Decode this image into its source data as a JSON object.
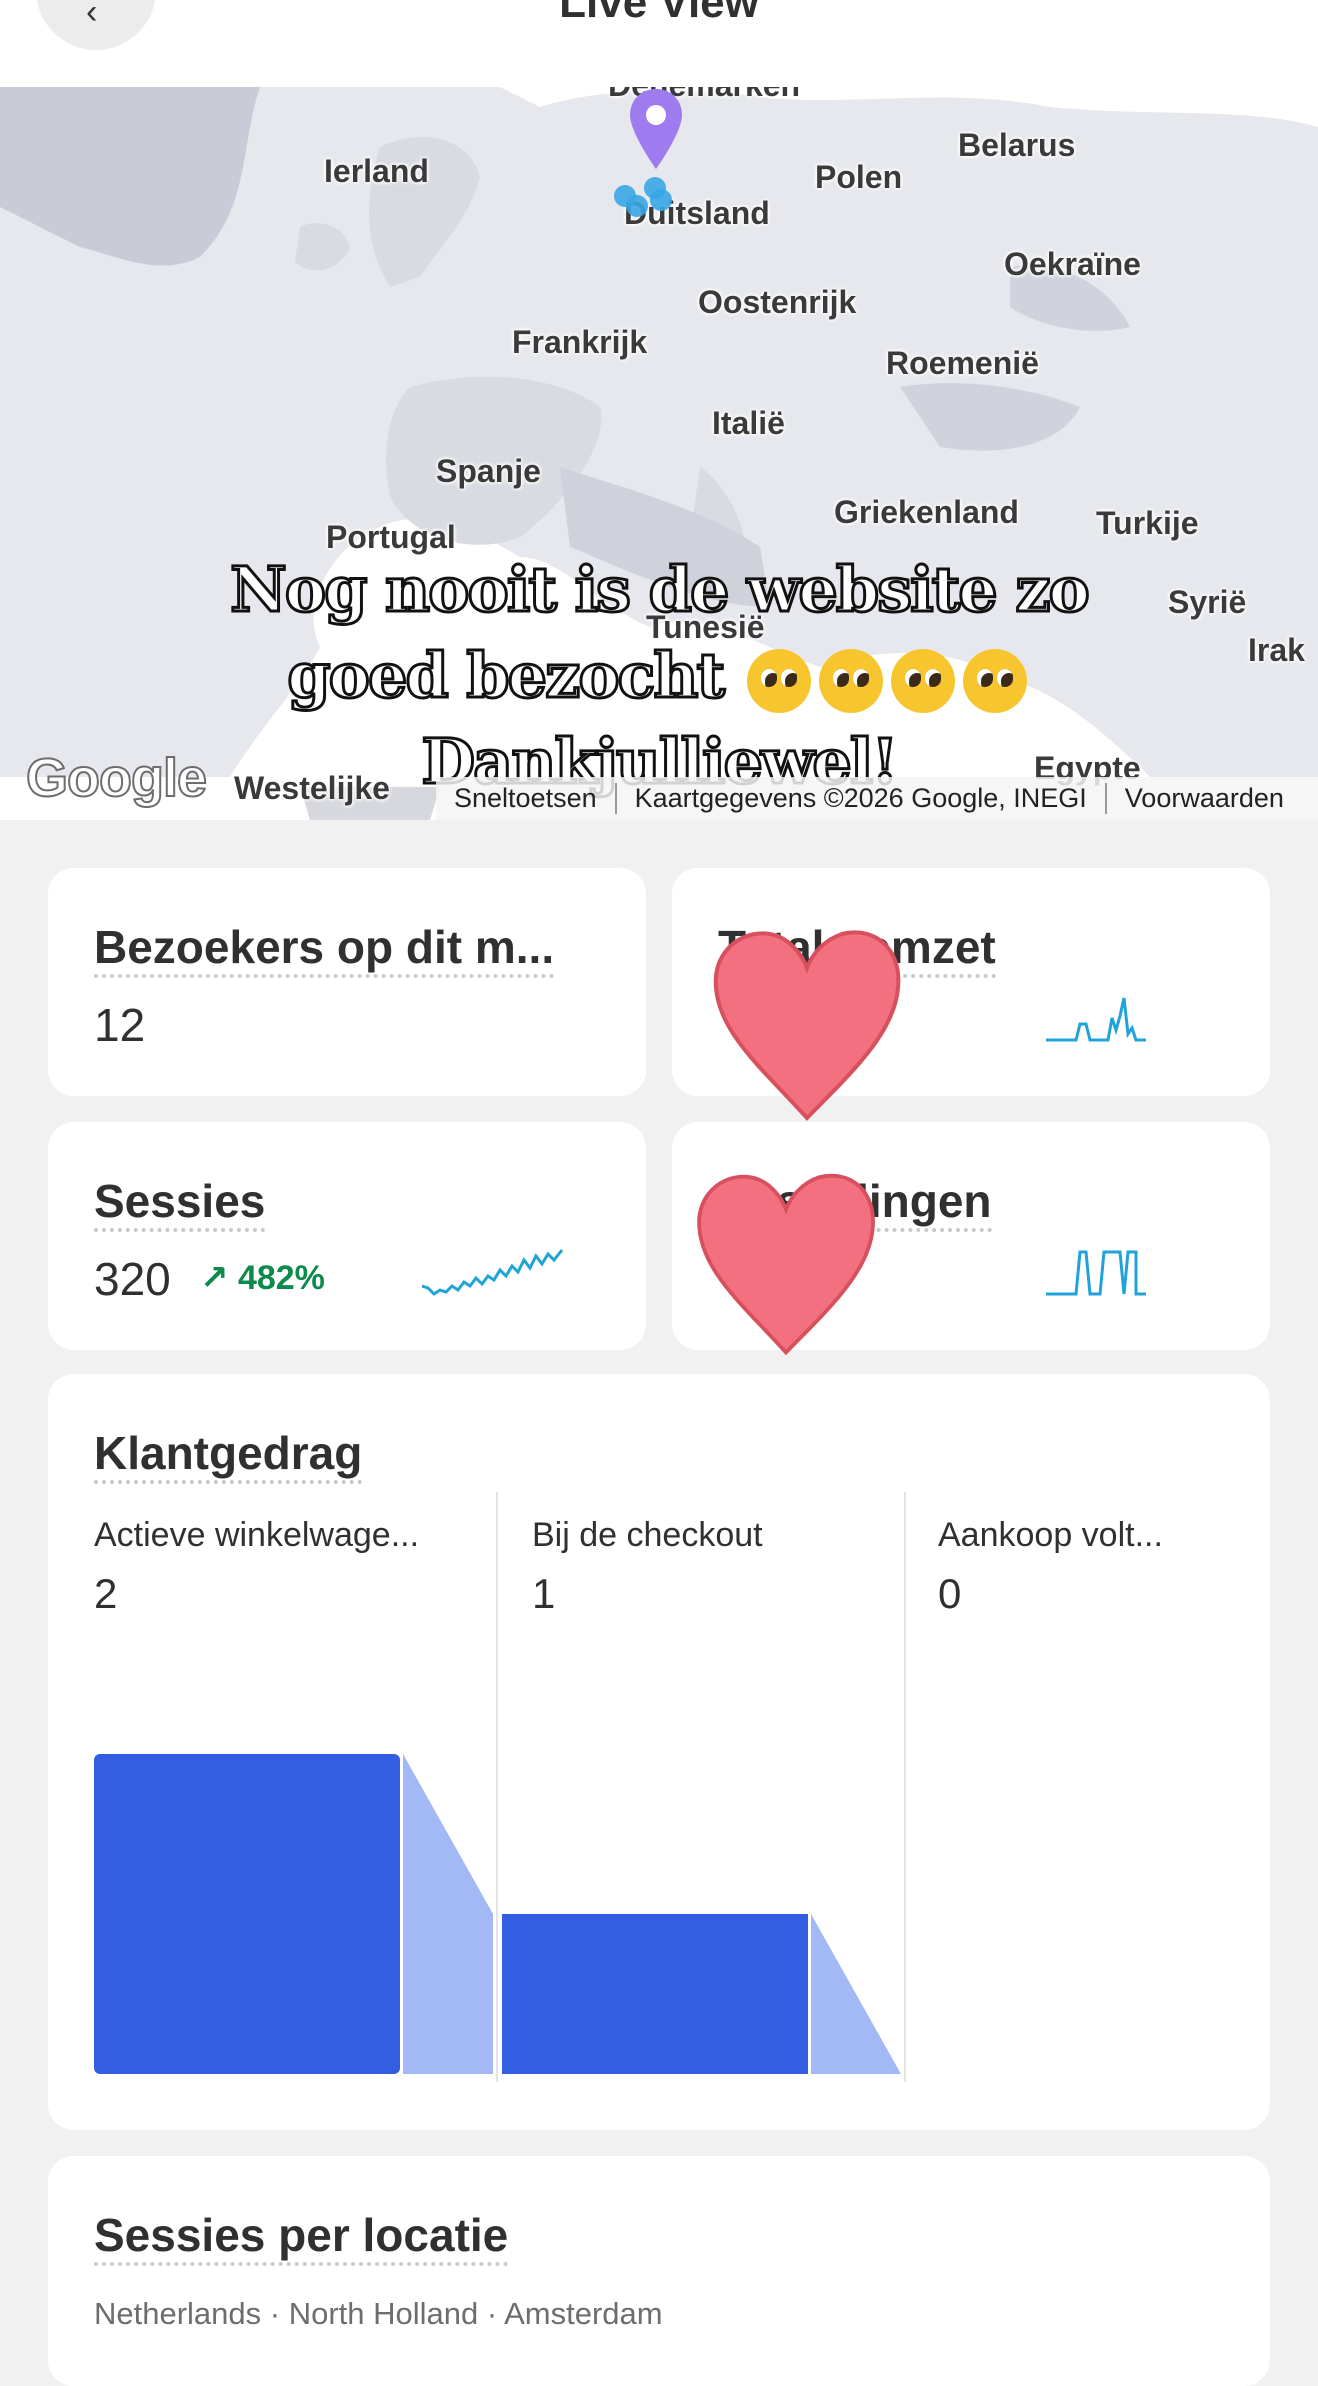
{
  "header": {
    "title": "Live View",
    "back_icon": "chevron-left-icon"
  },
  "map": {
    "countries": [
      "Denemarken",
      "Ierland",
      "Belarus",
      "Polen",
      "Duitsland",
      "Oekraïne",
      "Oostenrijk",
      "Frankrijk",
      "Roemenië",
      "Italië",
      "Spanje",
      "Griekenland",
      "Turkije",
      "Portugal",
      "Syrië",
      "Tunesië",
      "Irak",
      "Egypte",
      "Westelijke"
    ],
    "footer": {
      "shortcuts": "Sneltoetsen",
      "data": "Kaartgegevens ©2026 Google, INEGI",
      "terms": "Voorwaarden"
    },
    "logo": "Google",
    "caption_line1": "Nog nooit is de website zo",
    "caption_line2": "goed bezocht",
    "caption_line3": "Dankjulliewel!",
    "pin_color": "#9f7bf0",
    "dot_color": "#38a6e4"
  },
  "metrics": {
    "visitors": {
      "title": "Bezoekers op dit m...",
      "value": "12"
    },
    "revenue": {
      "title": "Totale omzet",
      "spark_color": "#1fa3d9"
    },
    "sessions": {
      "title": "Sessies",
      "value": "320",
      "trend": "482%",
      "trend_icon": "arrow-up-right-icon",
      "spark_color": "#1fa3d9"
    },
    "orders": {
      "title": "Bestellingen",
      "spark_color": "#1fa3d9"
    }
  },
  "behavior": {
    "title": "Klantgedrag",
    "columns": [
      {
        "label": "Actieve winkelwage...",
        "value": "2"
      },
      {
        "label": "Bij de checkout",
        "value": "1"
      },
      {
        "label": "Aankoop volt...",
        "value": "0"
      }
    ],
    "chart_data": {
      "type": "bar",
      "categories": [
        "Actieve winkelwage...",
        "Bij de checkout",
        "Aankoop volt..."
      ],
      "values": [
        2,
        1,
        0
      ],
      "ylim": [
        0,
        2
      ]
    },
    "bar_color": "#335ee3",
    "funnel_color": "#a3b9f6"
  },
  "locations": {
    "title": "Sessies per locatie",
    "first_row": "Netherlands · North Holland · Amsterdam"
  }
}
